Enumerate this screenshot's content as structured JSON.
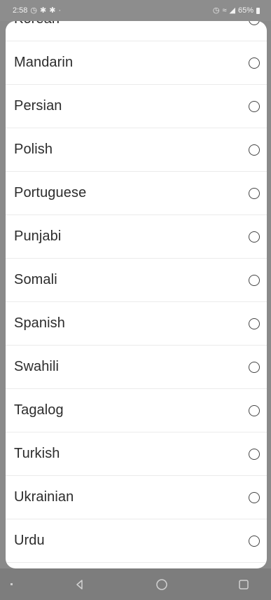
{
  "status_bar": {
    "time": "2:58",
    "battery_percent": "65%"
  },
  "languages": [
    {
      "label": "Korean",
      "selected": false
    },
    {
      "label": "Mandarin",
      "selected": false
    },
    {
      "label": "Persian",
      "selected": false
    },
    {
      "label": "Polish",
      "selected": false
    },
    {
      "label": "Portuguese",
      "selected": false
    },
    {
      "label": "Punjabi",
      "selected": false
    },
    {
      "label": "Somali",
      "selected": false
    },
    {
      "label": "Spanish",
      "selected": false
    },
    {
      "label": "Swahili",
      "selected": false
    },
    {
      "label": "Tagalog",
      "selected": false
    },
    {
      "label": "Turkish",
      "selected": false
    },
    {
      "label": "Ukrainian",
      "selected": false
    },
    {
      "label": "Urdu",
      "selected": false
    }
  ],
  "nav_bar": {
    "icons": [
      "back-icon",
      "home-icon",
      "recents-icon"
    ]
  },
  "colors": {
    "status_bar_bg": "#8d8d8d",
    "nav_bar_bg": "#7d7d7d",
    "sheet_bg": "#ffffff",
    "divider": "#ebebeb",
    "text": "#2c2c2c"
  }
}
